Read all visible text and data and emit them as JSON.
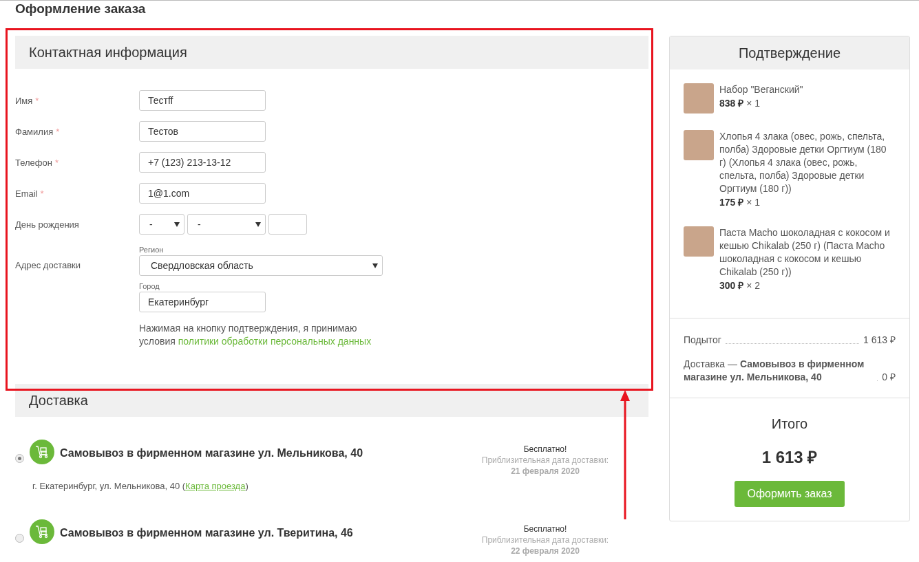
{
  "page_title": "Оформление заказа",
  "contact": {
    "title": "Контактная информация",
    "fields": [
      {
        "kind": "text",
        "label": "Имя",
        "required_mark": "*",
        "value": "Тестff"
      },
      {
        "kind": "text",
        "label": "Фамилия",
        "required_mark": "*",
        "value": "Тестов"
      },
      {
        "kind": "text",
        "label": "Телефон",
        "required_mark": "*",
        "value": "+7 (123) 213-13-12"
      },
      {
        "kind": "text",
        "label": "Email",
        "required_mark": "*",
        "value": "1@1.com"
      },
      {
        "kind": "date",
        "label": "День рождения",
        "day": "-",
        "month": "-"
      },
      {
        "kind": "address",
        "label": "Адрес доставки",
        "region_label": "Регион",
        "region": "Свердловская область",
        "city_label": "Город",
        "city": "Екатеринбург"
      }
    ],
    "consent": "Нажимая на кнопку подтверждения, я принимаю условия",
    "consent_link": "политики обработки персональных данных"
  },
  "delivery": {
    "title": "Доставка",
    "options": [
      {
        "name": "Самовывоз в фирменном магазине ул. Мельникова, 40",
        "selected": true,
        "price": "Бесплатно!",
        "date_label": "Приблизительная дата доставки:",
        "date": "21 февраля 2020",
        "address": "г. Екатеринбург, ул. Мельникова, 40 (",
        "map_link": "Карта проезда",
        "address_end": ")"
      },
      {
        "name": "Самовывоз в фирменном магазине ул. Тверитина, 46",
        "selected": false,
        "price": "Бесплатно!",
        "date_label": "Приблизительная дата доставки:",
        "date": "22 февраля 2020"
      }
    ]
  },
  "summary": {
    "title": "Подтверждение",
    "items": [
      {
        "name": "Набор \"Веганский\"",
        "price": "838 ₽",
        "qty": "× 1"
      },
      {
        "name": "Хлопья 4 злака (овес, рожь, спельта, полба) Здоровые детки Оргтиум (180 г) (Хлопья 4 злака (овес, рожь, спельта, полба) Здоровые детки Оргтиум (180 г))",
        "price": "175 ₽",
        "qty": "× 1"
      },
      {
        "name": "Паста Macho шоколадная с кокосом и кешью Chikalab (250 г) (Паста Macho шоколадная с кокосом и кешью Chikalab (250 г))",
        "price": "300 ₽",
        "qty": "× 2"
      }
    ],
    "subtotal_label": "Подытог",
    "subtotal": "1 613 ₽",
    "delivery_label": "Доставка — **Самовывоз в фирменном магазине ул. Мельникова, 40**",
    "delivery_cost": "0 ₽",
    "total_label": "Итого",
    "total": "1 613 ₽",
    "button": "Оформить заказ"
  },
  "annotations": {
    "frame": true,
    "arrow": true
  }
}
